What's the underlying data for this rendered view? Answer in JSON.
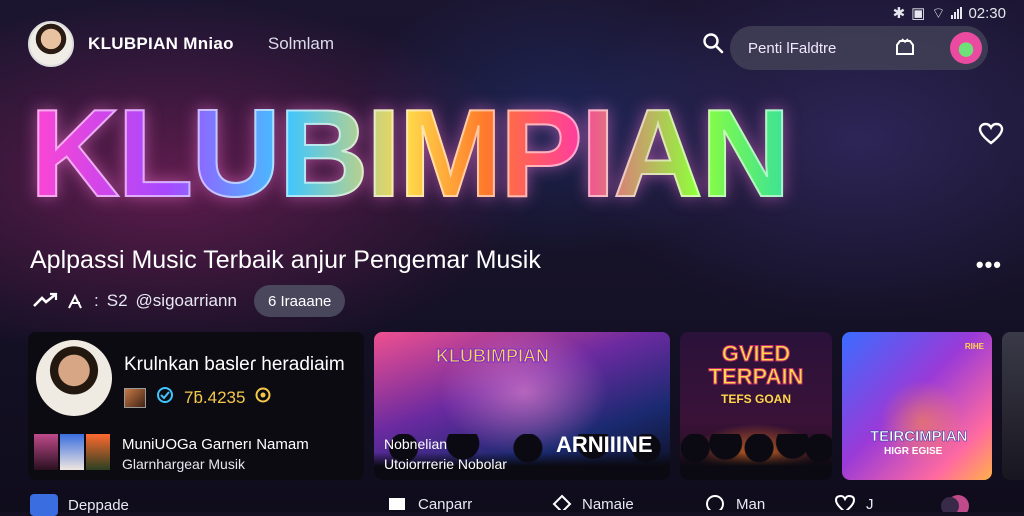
{
  "status": {
    "time": "02:30"
  },
  "header": {
    "app_name": "KLUBPIAN Mniao",
    "subtitle": "Solmlam",
    "search_placeholder": "Penti lFaldtre"
  },
  "hero": {
    "title": "KLUBIMPIAN",
    "tagline": "Aplpassi Music Terbaik anjur Pengemar Musik",
    "meta_stat": "S2",
    "meta_handle": "@sigoarriann",
    "chip": "6 Iraaane",
    "more": "•••"
  },
  "profile_card": {
    "name": "Krulnkan basleɾ heradiaim",
    "count": "7ƃ.4235",
    "line1": "MuniUOGa Garnerı Namam",
    "line2": "Glarnhargear Musik"
  },
  "cards": [
    {
      "tag": "KLUBIMPIAN",
      "big": "ARNIIINE",
      "line1": "Nobnelian",
      "line2": "Utoiorrrerie Nobolar"
    },
    {
      "tag": "GVIED TERPAIN",
      "small": "TEFS GOAN"
    },
    {
      "tag": "TEIRCIMPIAN",
      "small": "HIGR EGISE",
      "badge": "RIHE"
    }
  ],
  "nav": [
    {
      "label": "Deppade"
    },
    {
      "label": "Canparr"
    },
    {
      "label": "Namaie"
    },
    {
      "label": "Man"
    },
    {
      "label": "J"
    }
  ],
  "colors": {
    "accent": "#f6c84a",
    "nav_icon": "#3a6ee0"
  }
}
